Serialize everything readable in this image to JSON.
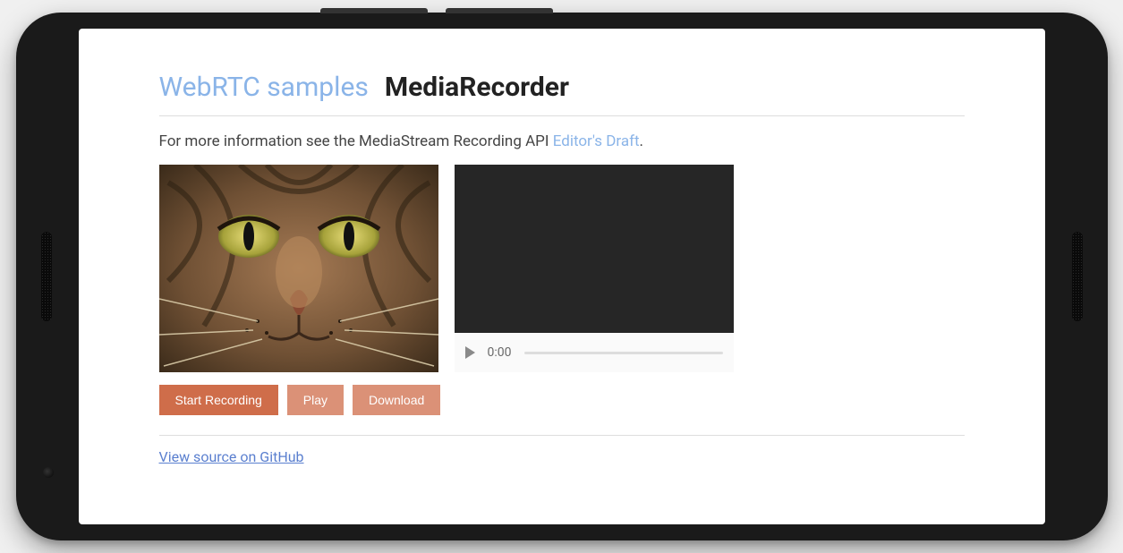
{
  "header": {
    "title_link": "WebRTC samples",
    "page_title": "MediaRecorder"
  },
  "intro": {
    "prefix": "For more information see the MediaStream Recording API ",
    "link_text": "Editor's Draft",
    "suffix": "."
  },
  "media": {
    "preview_alt": "camera-preview",
    "player_time": "0:00"
  },
  "buttons": {
    "start": "Start Recording",
    "play": "Play",
    "download": "Download"
  },
  "footer": {
    "source_link": "View source on GitHub"
  },
  "colors": {
    "accent": "#cf6d4a",
    "link": "#8ab4e8"
  }
}
